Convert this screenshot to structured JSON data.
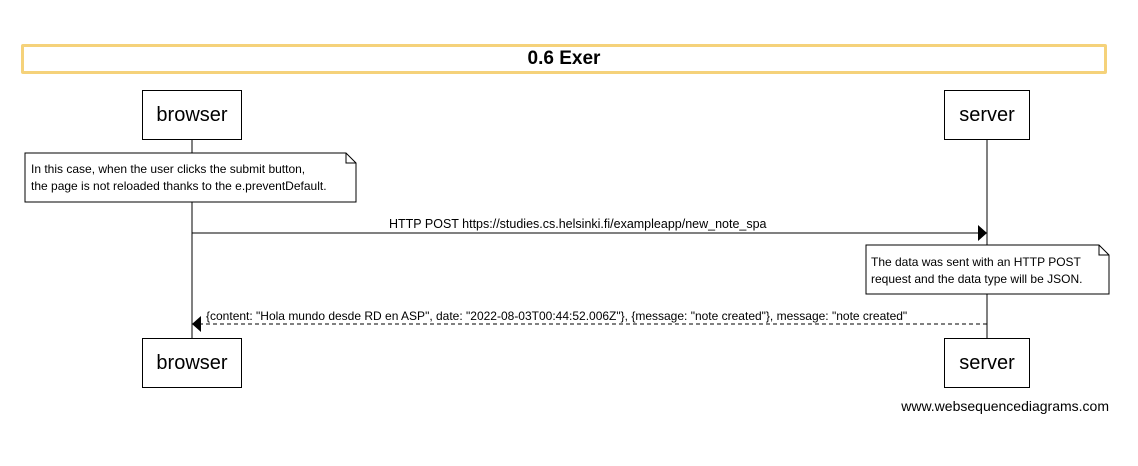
{
  "diagram": {
    "title": "0.6 Exer",
    "participants": {
      "browser": "browser",
      "server": "server"
    },
    "notes": {
      "browser_note": [
        "In this case, when the user clicks the submit button,",
        "the page is not reloaded thanks to the e.preventDefault."
      ],
      "server_note": [
        "The data was sent with an HTTP POST",
        "request and the data type will be JSON."
      ]
    },
    "messages": [
      {
        "from": "browser",
        "to": "server",
        "style": "solid",
        "label": "HTTP POST https://studies.cs.helsinki.fi/exampleapp/new_note_spa"
      },
      {
        "from": "server",
        "to": "browser",
        "style": "dashed",
        "label": "{content: \"Hola mundo desde RD en ASP\", date: \"2022-08-03T00:44:52.006Z\"}, {message: \"note created\"}, message: \"note created\""
      }
    ],
    "footer": "www.websequencediagrams.com"
  },
  "colors": {
    "title_border": "#f5d27a",
    "line": "#000000",
    "background": "#ffffff"
  }
}
